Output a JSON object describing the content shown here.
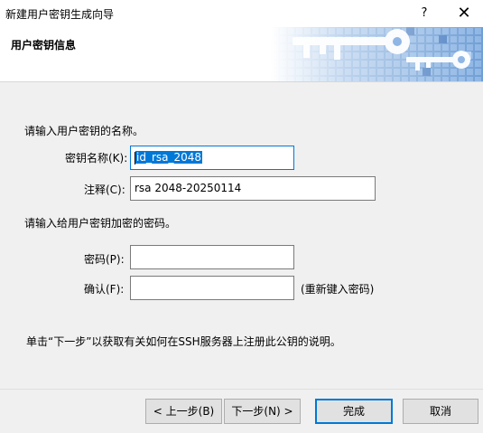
{
  "window": {
    "title": "新建用户密钥生成向导",
    "help_label": "?",
    "close_label": "✕"
  },
  "header": {
    "title": "用户密钥信息",
    "banner_icon": "key-icon"
  },
  "form": {
    "intro_name": "请输入用户密钥的名称。",
    "key_name_label": "密钥名称(K):",
    "key_name_value": "id_rsa_2048",
    "comment_label": "注释(C):",
    "comment_value": "rsa 2048-20250114",
    "intro_password": "请输入给用户密钥加密的密码。",
    "password_label": "密码(P):",
    "password_value": "",
    "confirm_label": "确认(F):",
    "confirm_value": "",
    "reenter_hint": "(重新键入密码)",
    "note": "单击“下一步”以获取有关如何在SSH服务器上注册此公钥的说明。"
  },
  "buttons": {
    "back": "< 上一步(B)",
    "next": "下一步(N) >",
    "finish": "完成",
    "cancel": "取消"
  },
  "colors": {
    "accent": "#0078d7",
    "panel": "#f0f0f0",
    "banner_blue": "#5b8fcc"
  }
}
